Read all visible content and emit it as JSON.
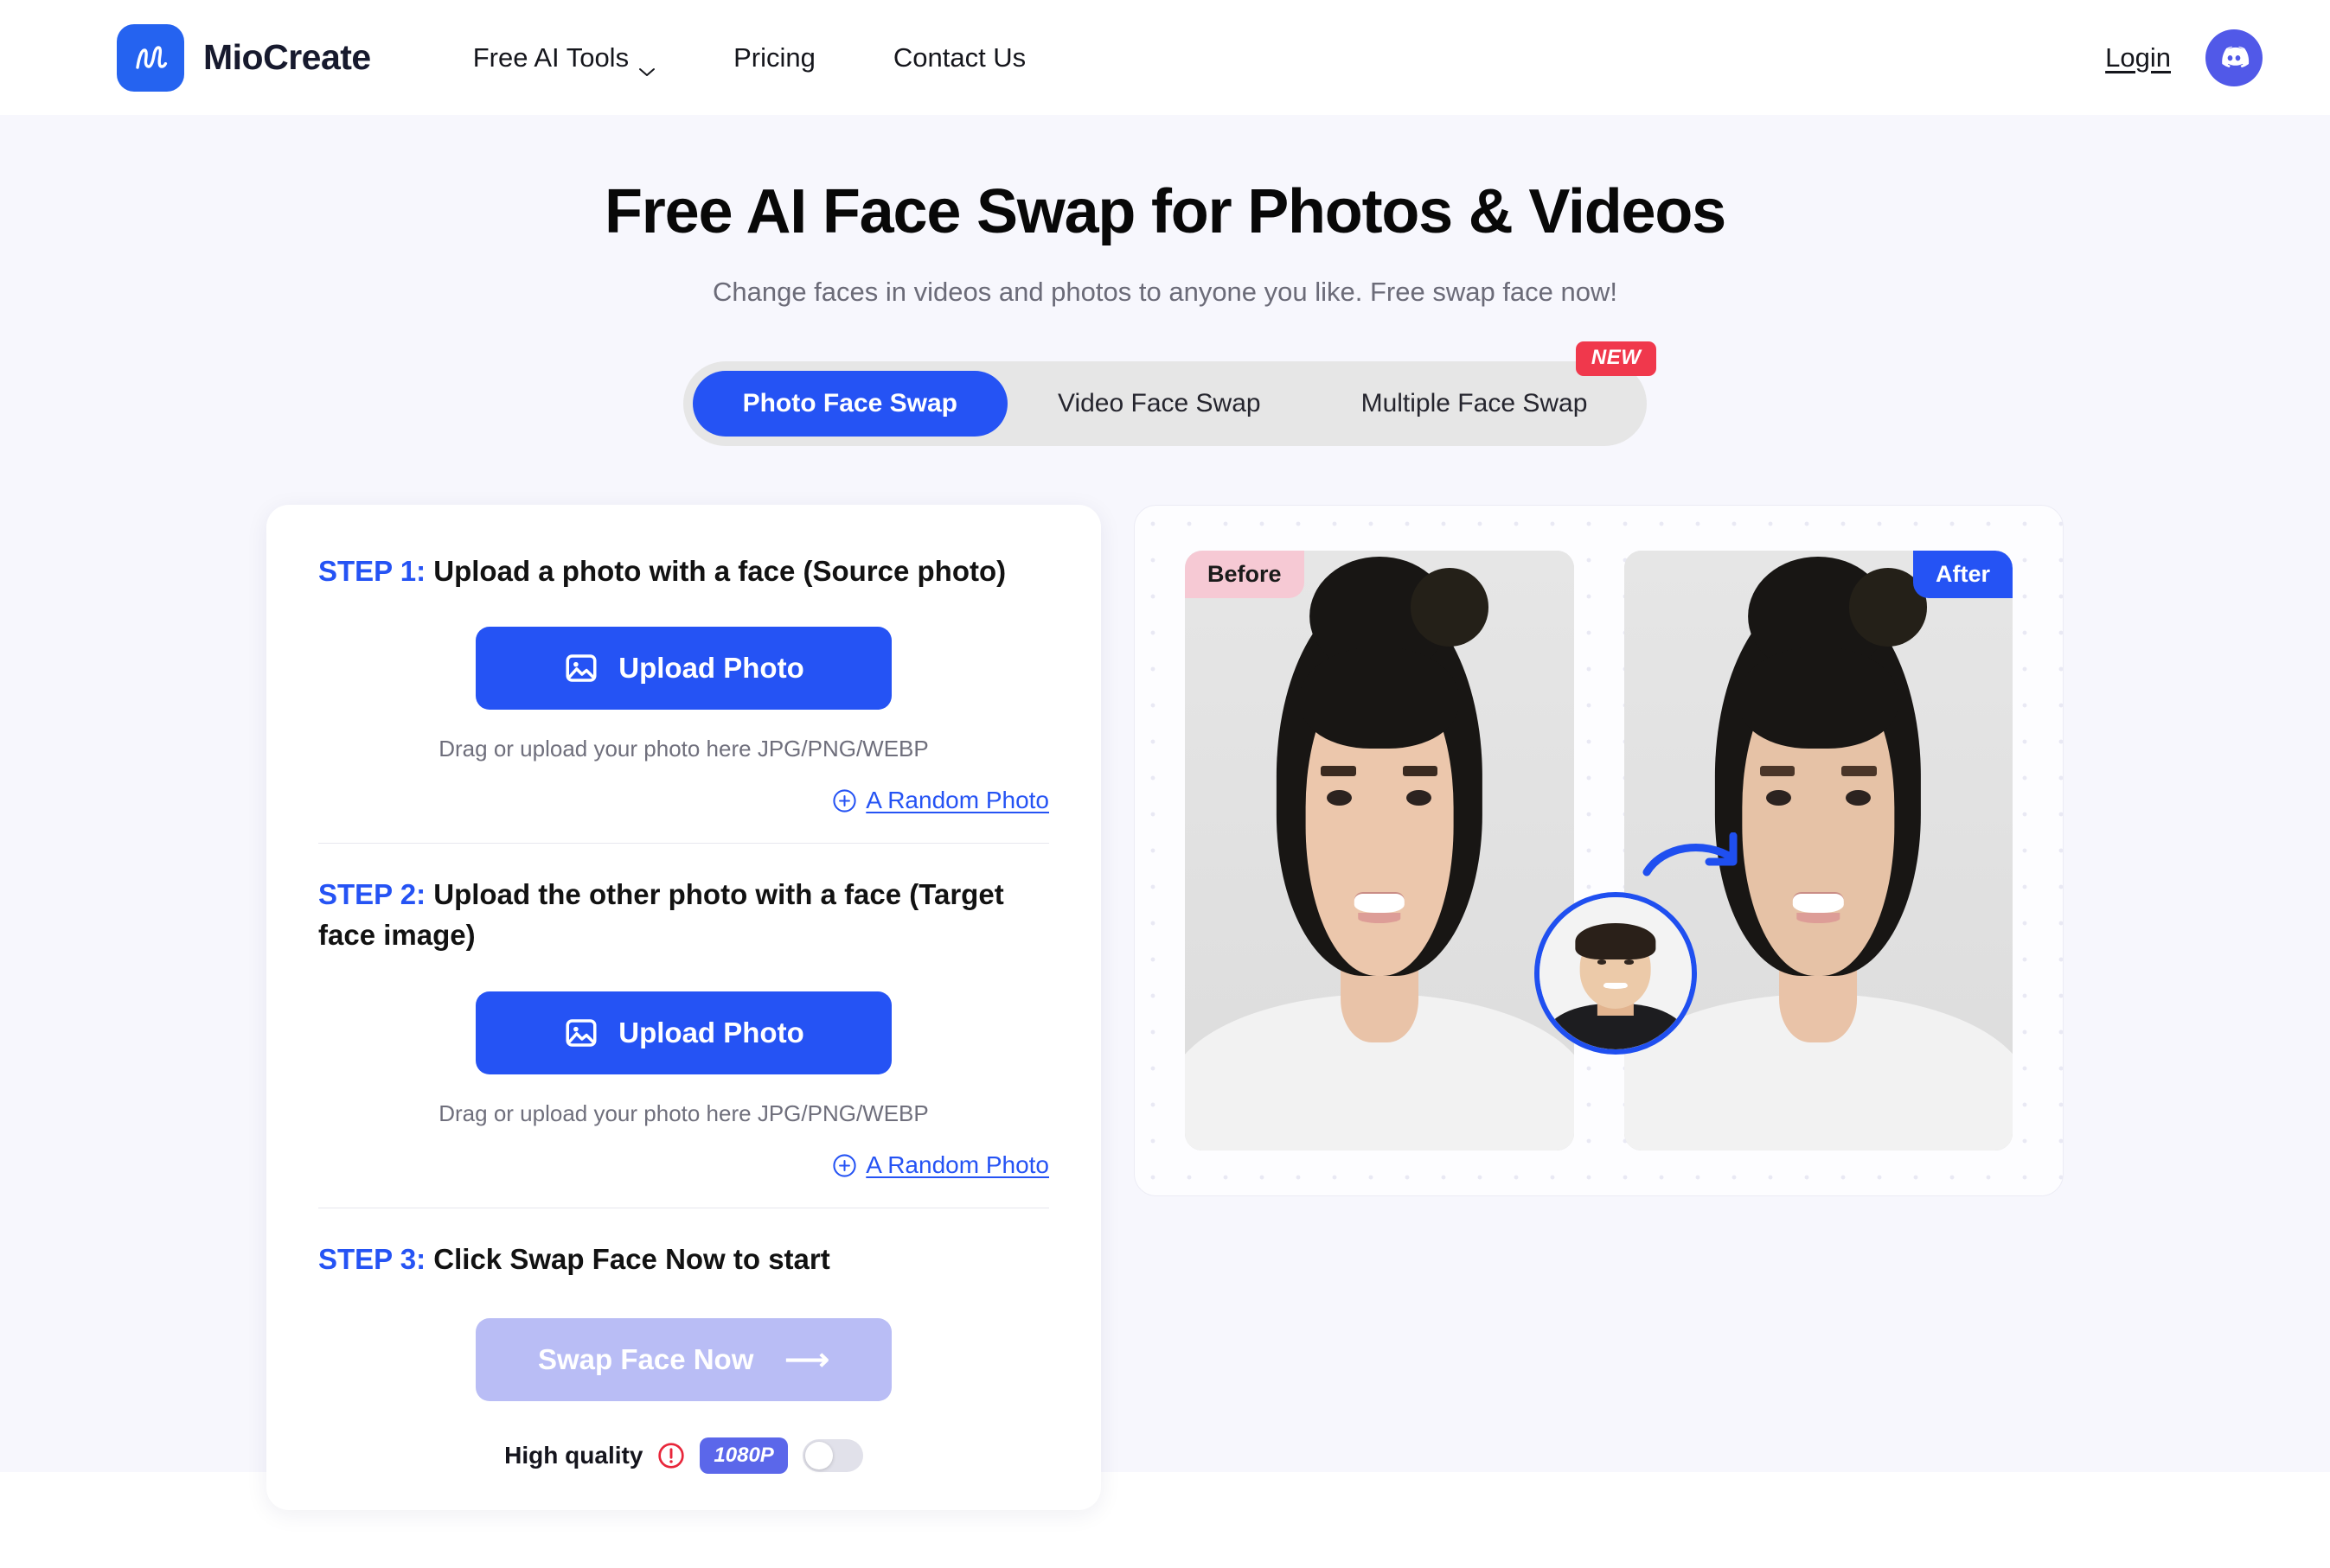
{
  "header": {
    "brand_name": "MioCreate",
    "logo_icon": "m-script-logo-icon",
    "nav": [
      {
        "label": "Free AI Tools",
        "has_chevron": true,
        "icon": "chevron-down-icon"
      },
      {
        "label": "Pricing",
        "has_chevron": false
      },
      {
        "label": "Contact Us",
        "has_chevron": false
      }
    ],
    "login_label": "Login",
    "discord_icon": "discord-icon"
  },
  "hero": {
    "title": "Free AI Face Swap for Photos & Videos",
    "subtitle": "Change faces in videos and photos to anyone you like. Free swap face now!"
  },
  "tabs": {
    "items": [
      {
        "label": "Photo Face Swap",
        "active": true,
        "badge": null
      },
      {
        "label": "Video Face Swap",
        "active": false,
        "badge": null
      },
      {
        "label": "Multiple Face Swap",
        "active": false,
        "badge": "NEW"
      }
    ]
  },
  "steps": {
    "step1": {
      "number": "STEP 1:",
      "text": " Upload a photo with a face (Source photo)",
      "upload_label": "Upload Photo",
      "upload_icon": "image-upload-icon",
      "hint": "Drag or upload your photo here JPG/PNG/WEBP",
      "random_label": "A Random Photo",
      "random_icon": "plus-circle-icon"
    },
    "step2": {
      "number": "STEP 2:",
      "text": " Upload the other photo with a face (Target face image)",
      "upload_label": "Upload Photo",
      "upload_icon": "image-upload-icon",
      "hint": "Drag or upload your photo here JPG/PNG/WEBP",
      "random_label": "A Random Photo",
      "random_icon": "plus-circle-icon"
    },
    "step3": {
      "number": "STEP 3:",
      "text": " Click Swap Face Now to start",
      "swap_label": "Swap Face Now",
      "swap_arrow": "arrow-right-icon",
      "swap_disabled": true,
      "quality_label": "High quality",
      "quality_info_icon": "exclamation-circle-icon",
      "resolution_badge": "1080P",
      "toggle_state": "off"
    }
  },
  "preview": {
    "before_label": "Before",
    "after_label": "After",
    "source_face_icon": "source-face-avatar",
    "transform_arrow_icon": "curved-arrow-right-icon"
  },
  "colors": {
    "accent_blue": "#2553f4",
    "page_bg": "#f7f7fd",
    "badge_red": "#f0384c",
    "before_pink": "#f6c9d4",
    "disabled_blue": "#b9bdf5",
    "resolution_purple": "#5b67ea"
  }
}
